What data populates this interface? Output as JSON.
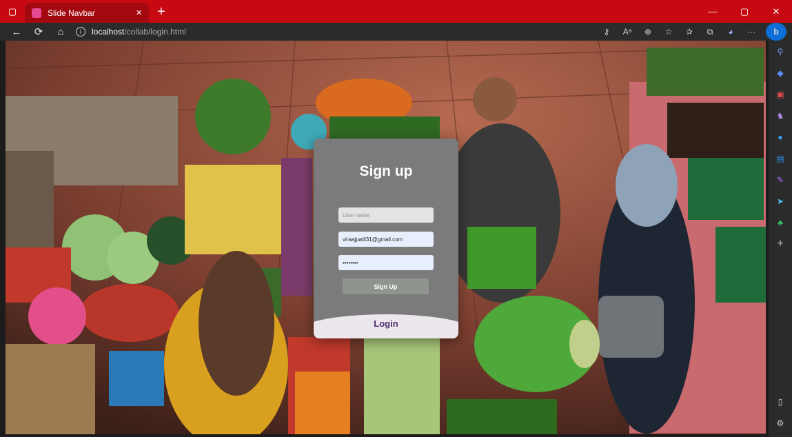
{
  "browser": {
    "tab_title": "Slide Navbar",
    "tab_close": "×",
    "new_tab": "+",
    "url_host": "localhost",
    "url_path": "/collab/login.html",
    "window_controls": {
      "minimize": "—",
      "restore": "▢",
      "close": "✕"
    },
    "nav": {
      "back": "←",
      "reload": "⟳",
      "home": "⌂"
    },
    "toolbar_glyphs": {
      "key": "⚷",
      "read_aloud": "Aᵃ",
      "zoom": "⊕",
      "favorite_add": "☆",
      "favorites": "✰",
      "collections": "⧉",
      "more": "···",
      "copilot": "b"
    },
    "sidebar_glyphs": {
      "search": "⚲",
      "tag": "◆",
      "tools": "▣",
      "games": "♞",
      "office": "●",
      "outlook": "▤",
      "designer": "✎",
      "send": "➤",
      "tree": "♣",
      "add": "+",
      "panel": "▯",
      "settings": "⚙"
    }
  },
  "form": {
    "title": "Sign up",
    "username_placeholder": "User name",
    "email_value": "viraajpatil31@gmail.com",
    "password_value": "••••••••",
    "signup_button": "Sign Up",
    "login_label": "Login"
  },
  "colors": {
    "titlebar": "#c70a12",
    "card": "#7b7b7b",
    "login_text": "#4a2d6e",
    "sidebar_search": "#6fa0ff",
    "sidebar_tag": "#5b8cff",
    "sidebar_tools": "#e24b4b",
    "sidebar_games": "#b38be8",
    "sidebar_office": "#3aa0ff",
    "sidebar_outlook": "#2f8ce0",
    "sidebar_designer": "#b36bff",
    "sidebar_send": "#4fc3f7",
    "sidebar_tree": "#3cc46a"
  }
}
